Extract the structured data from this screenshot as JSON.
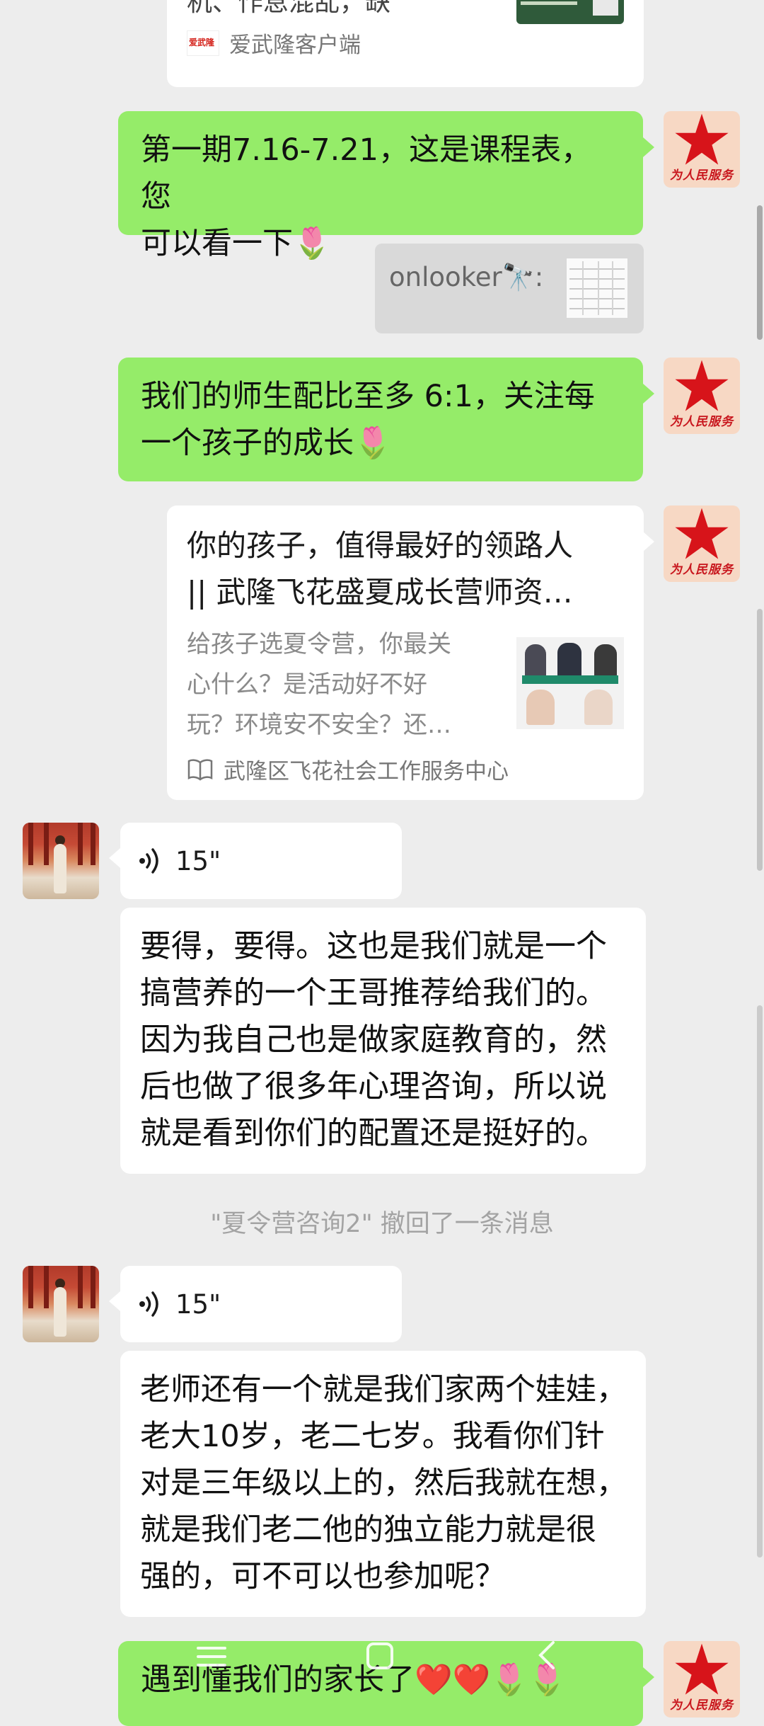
{
  "top_card": {
    "title_tail": "机、作息混乱，缺",
    "source": "爱武隆客户端",
    "source_logo_text": "爱武隆"
  },
  "messages": {
    "m1": {
      "line1": "第一期7.16-7.21，这是课程表，您",
      "line2": "可以看一下",
      "emoji": "🌷"
    },
    "quote1": {
      "text": "onlooker🔭:"
    },
    "m2": {
      "line1": "我们的师生配比至多 6:1，关注每",
      "line2": "一个孩子的成长",
      "emoji": "🌷"
    },
    "article": {
      "title_line1": "你的孩子，值得最好的领路人",
      "title_line2": "|| 武隆飞花盛夏成长营师资…",
      "desc_line1": "给孩子选夏令营，你最关",
      "desc_line2": "心什么？是活动好不好",
      "desc_line3": "玩？环境安不安全？还…",
      "source": "武隆区飞花社会工作服务中心"
    },
    "voice1": {
      "duration": "15\""
    },
    "m3": {
      "line1": "要得，要得。这也是我们就是一个",
      "line2": "搞营养的一个王哥推荐给我们的。",
      "line3": "因为我自己也是做家庭教育的，然",
      "line4": "后也做了很多年心理咨询，所以说",
      "line5": "就是看到你们的配置还是挺好的。"
    },
    "recall_notice": "\"夏令营咨询2\" 撤回了一条消息",
    "voice2": {
      "duration": "15\""
    },
    "m4": {
      "line1": "老师还有一个就是我们家两个娃娃，",
      "line2": "老大10岁，老二七岁。我看你们针",
      "line3": "对是三年级以上的，然后我就在想，",
      "line4": "就是我们老二他的独立能力就是很",
      "line5": "强的，可不可以也参加呢？"
    },
    "m5": {
      "text": "遇到懂我们的家长了",
      "emoji": "❤️❤️🌷🌷"
    }
  },
  "avatar": {
    "slogan": "为人民服务"
  },
  "colors": {
    "bubble_green": "#95ec69",
    "background": "#ededed",
    "star_red": "#d7141a"
  }
}
